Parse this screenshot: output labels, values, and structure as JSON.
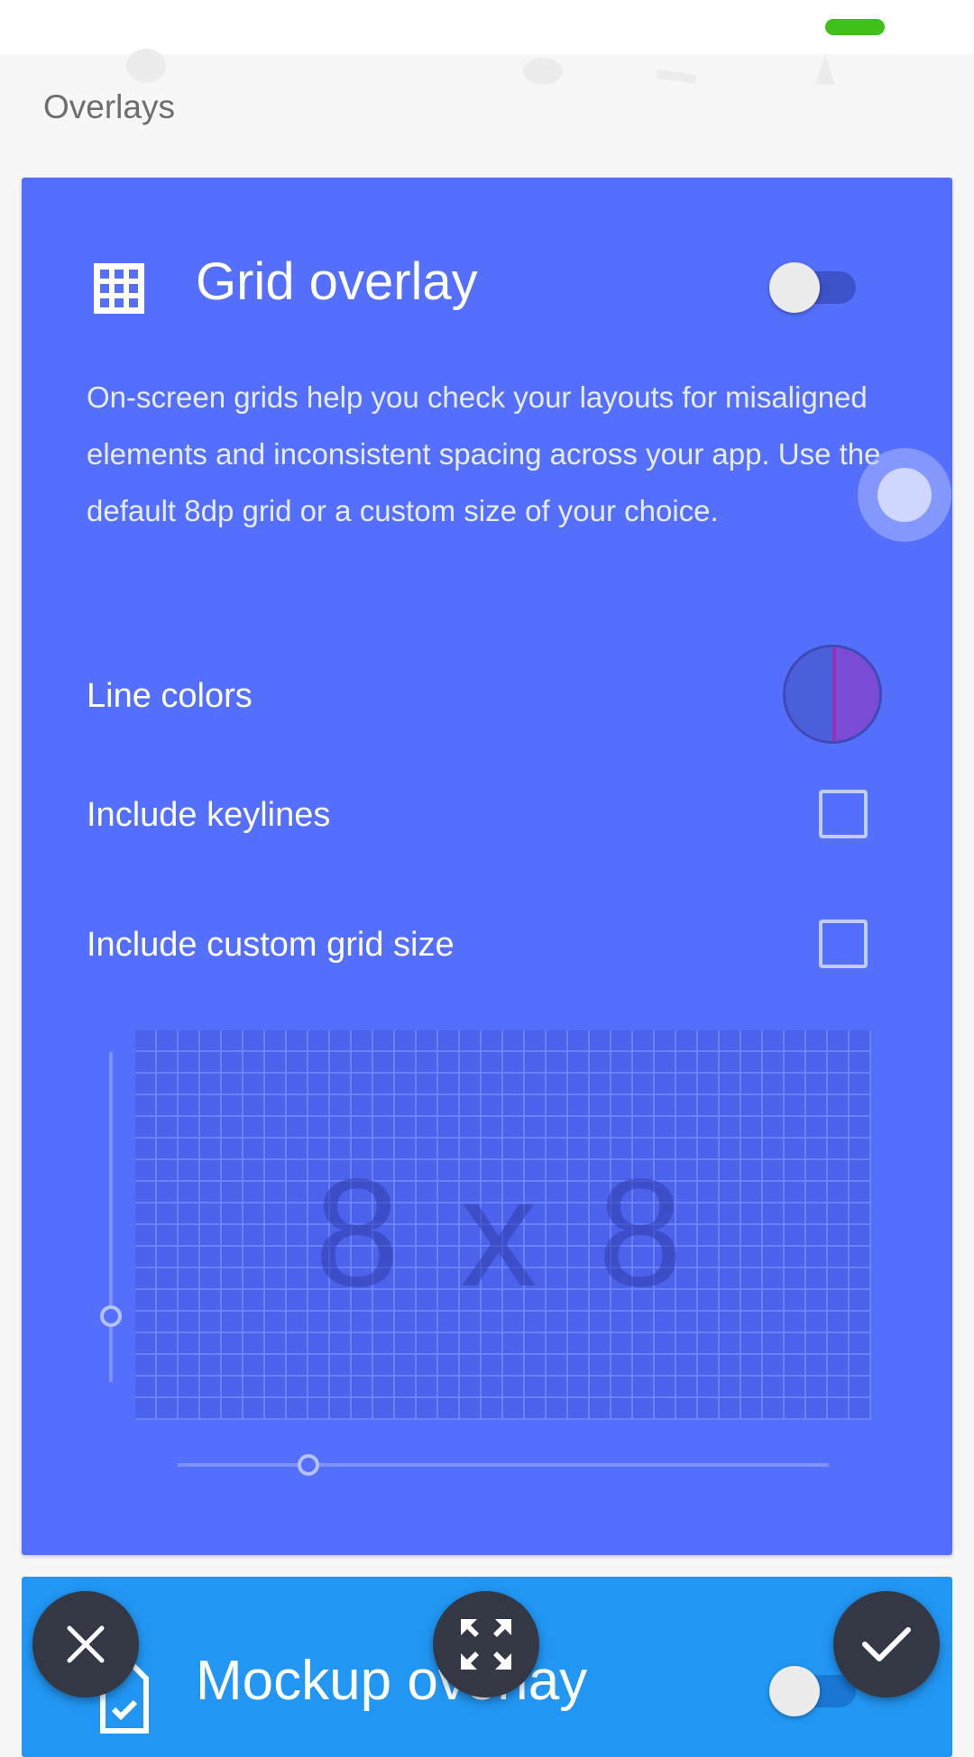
{
  "section_header": "Overlays",
  "grid_overlay": {
    "title": "Grid overlay",
    "enabled": false,
    "description": "On-screen grids help you check your layouts for misaligned elements and inconsistent spacing across your app. Use the default 8dp grid or a custom size of your choice.",
    "line_colors_label": "Line colors",
    "line_colors": [
      "#4b5fdb",
      "#7c4bd6"
    ],
    "include_keylines_label": "Include keylines",
    "include_keylines": false,
    "include_custom_grid_label": "Include custom grid size",
    "include_custom_grid": false,
    "grid_size_label": "8 x 8"
  },
  "mockup_overlay": {
    "title": "Mockup overlay",
    "enabled": false
  },
  "actions": {
    "close_icon": "close-icon",
    "fullscreen_icon": "fullscreen-icon",
    "confirm_icon": "check-icon"
  },
  "colors": {
    "grid_card": "#546ffb",
    "mockup_card": "#2196f3",
    "status_pill": "#3fc11a",
    "fab": "#333844"
  }
}
